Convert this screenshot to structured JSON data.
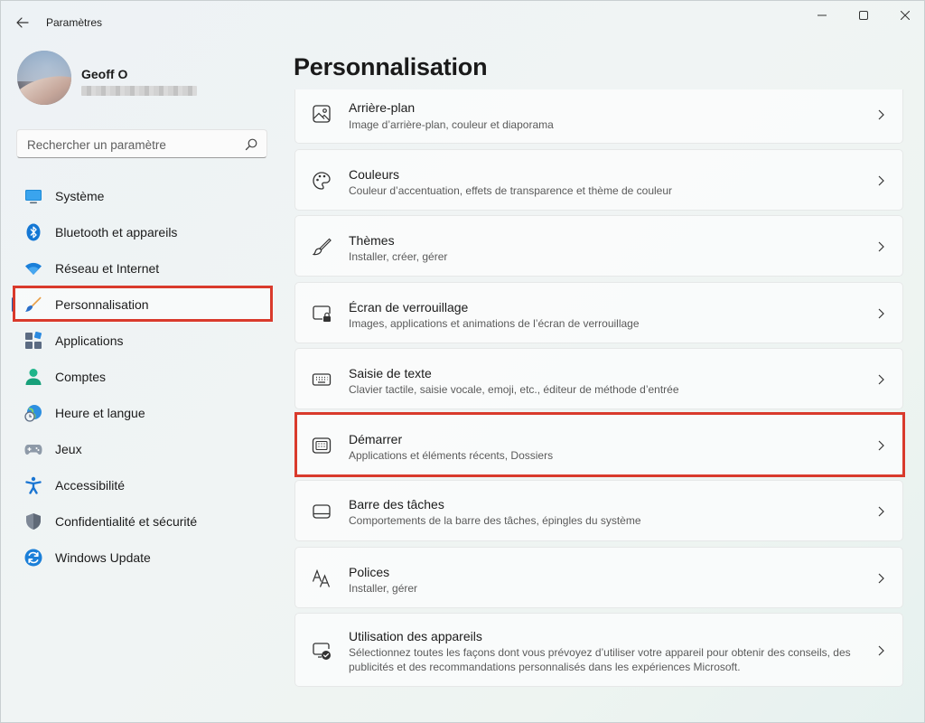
{
  "window": {
    "title": "Paramètres"
  },
  "profile": {
    "name": "Geoff O"
  },
  "search": {
    "placeholder": "Rechercher un paramètre"
  },
  "sidebar": {
    "items": [
      {
        "label": "Système",
        "icon": "monitor-icon"
      },
      {
        "label": "Bluetooth et appareils",
        "icon": "bluetooth-icon"
      },
      {
        "label": "Réseau et Internet",
        "icon": "wifi-icon"
      },
      {
        "label": "Personnalisation",
        "icon": "brush-icon",
        "selected": true
      },
      {
        "label": "Applications",
        "icon": "apps-icon"
      },
      {
        "label": "Comptes",
        "icon": "person-icon"
      },
      {
        "label": "Heure et langue",
        "icon": "globe-clock-icon"
      },
      {
        "label": "Jeux",
        "icon": "gamepad-icon"
      },
      {
        "label": "Accessibilité",
        "icon": "accessibility-icon"
      },
      {
        "label": "Confidentialité et sécurité",
        "icon": "shield-icon"
      },
      {
        "label": "Windows Update",
        "icon": "update-icon"
      }
    ]
  },
  "main": {
    "title": "Personnalisation",
    "cards": [
      {
        "title": "Arrière-plan",
        "desc": "Image d’arrière-plan, couleur et diaporama",
        "icon": "image-icon"
      },
      {
        "title": "Couleurs",
        "desc": "Couleur d’accentuation, effets de transparence et thème de couleur",
        "icon": "palette-icon"
      },
      {
        "title": "Thèmes",
        "desc": "Installer, créer, gérer",
        "icon": "brush-icon"
      },
      {
        "title": "Écran de verrouillage",
        "desc": "Images, applications et animations de l’écran de verrouillage",
        "icon": "lock-screen-icon"
      },
      {
        "title": "Saisie de texte",
        "desc": "Clavier tactile, saisie vocale, emoji, etc., éditeur de méthode d’entrée",
        "icon": "keyboard-icon"
      },
      {
        "title": "Démarrer",
        "desc": "Applications et éléments récents, Dossiers",
        "icon": "start-menu-icon"
      },
      {
        "title": "Barre des tâches",
        "desc": "Comportements de la barre des tâches, épingles du système",
        "icon": "taskbar-icon"
      },
      {
        "title": "Polices",
        "desc": "Installer, gérer",
        "icon": "font-icon"
      },
      {
        "title": "Utilisation des appareils",
        "desc": "Sélectionnez toutes les façons dont vous prévoyez d’utiliser votre appareil pour obtenir des conseils, des publicités et des recommandations personnalisés dans les expériences Microsoft.",
        "icon": "device-usage-icon"
      }
    ]
  },
  "colors": {
    "accent": "#1a5fb4",
    "highlight": "#d93a2c"
  }
}
